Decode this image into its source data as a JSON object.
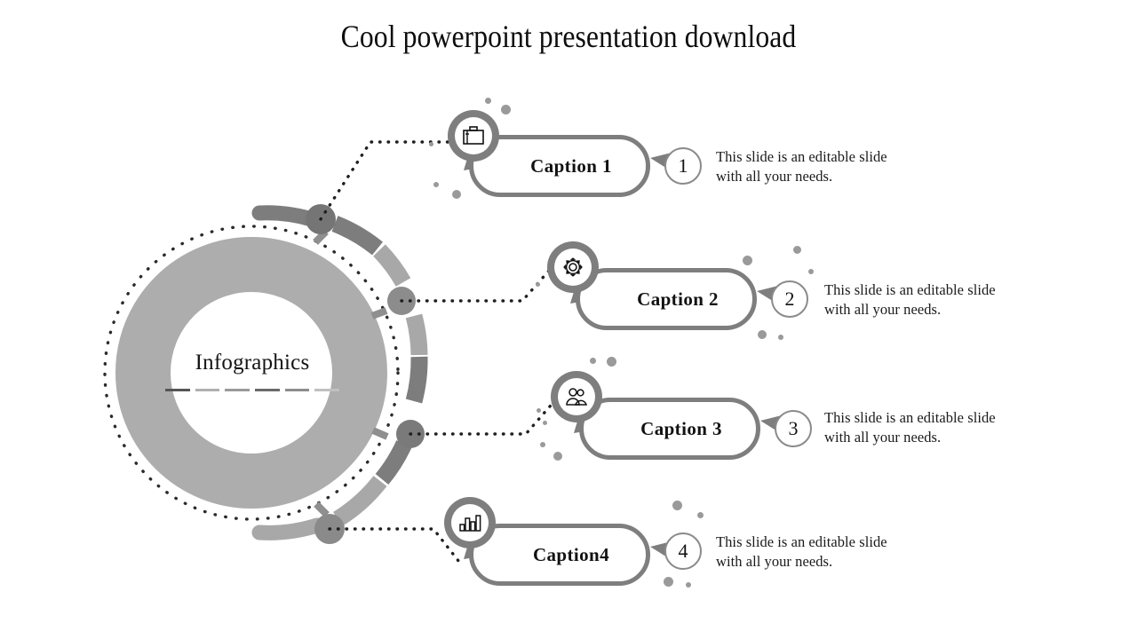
{
  "slide": {
    "title": "Cool powerpoint presentation download",
    "background_color": "#ffffff"
  },
  "hub": {
    "label": "Infographics",
    "ring_color": "#adadad",
    "dotted_ring_color": "#2b2b2b",
    "rule_segments": 6
  },
  "palette": {
    "arc_light": "#a8a8a8",
    "arc_dark": "#7d7d7d",
    "node": "#8a8a8a",
    "outline": "#7e7e7e",
    "text": "#121212",
    "dot": "#9a9a9a"
  },
  "items": [
    {
      "number": "1",
      "caption": "Caption 1",
      "icon": "briefcase-icon",
      "description": "This slide is an editable slide\nwith all your needs."
    },
    {
      "number": "2",
      "caption": "Caption 2",
      "icon": "gear-icon",
      "description": "This slide is an editable slide\nwith all your needs."
    },
    {
      "number": "3",
      "caption": "Caption 3",
      "icon": "users-icon",
      "description": "This slide is an editable slide\nwith all your needs."
    },
    {
      "number": "4",
      "caption": "Caption4",
      "icon": "bar-chart-icon",
      "description": "This slide is an editable slide\nwith all your needs."
    }
  ]
}
